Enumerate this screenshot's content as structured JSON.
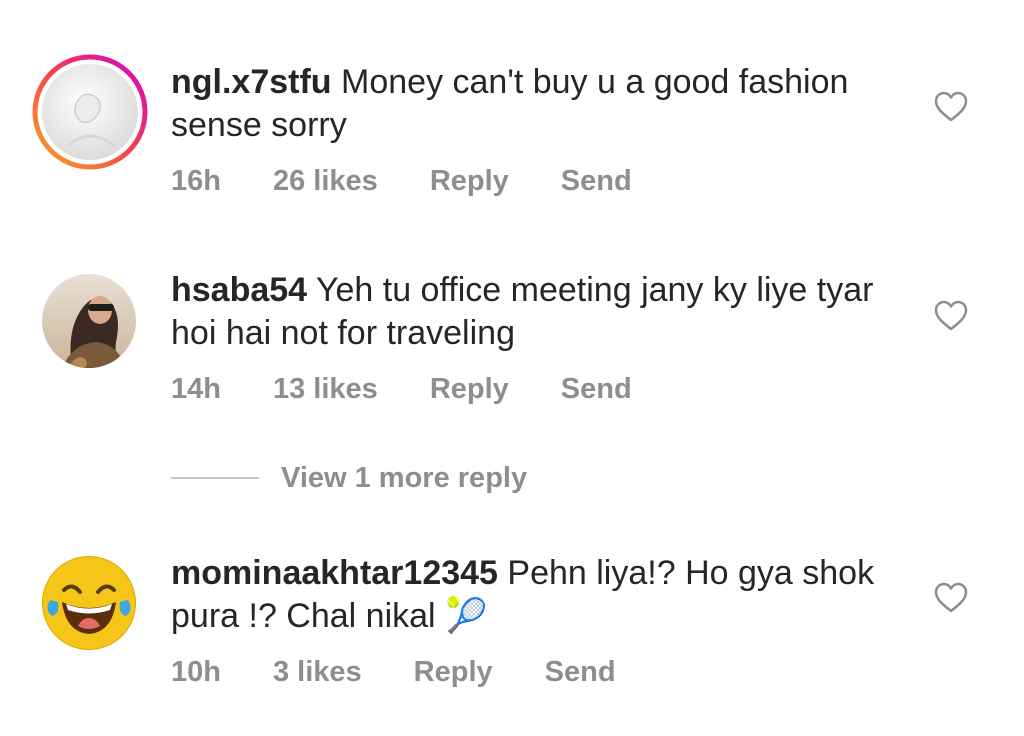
{
  "comments": [
    {
      "username": "ngl.x7stfu",
      "text": "Money can't buy u a good fashion sense sorry",
      "time": "16h",
      "likes": "26 likes",
      "reply_label": "Reply",
      "send_label": "Send",
      "avatar": "story-ring-avatar"
    },
    {
      "username": "hsaba54",
      "text": "Yeh tu office meeting jany ky liye tyar hoi hai not for traveling",
      "time": "14h",
      "likes": "13 likes",
      "reply_label": "Reply",
      "send_label": "Send",
      "avatar": "photo-avatar"
    },
    {
      "username": "mominaakhtar12345",
      "text": "Pehn liya!? Ho gya shok pura !? Chal nikal 🎾",
      "time": "10h",
      "likes": "3 likes",
      "reply_label": "Reply",
      "send_label": "Send",
      "avatar": "laughing-emoji-avatar"
    }
  ],
  "view_more": {
    "label": "View 1 more reply"
  },
  "icons": {
    "like": "heart-outline-icon"
  },
  "colors": {
    "text": "#262626",
    "secondary": "#8e8e8e",
    "story_ring_start": "#f9a825",
    "story_ring_end": "#d300c5"
  }
}
